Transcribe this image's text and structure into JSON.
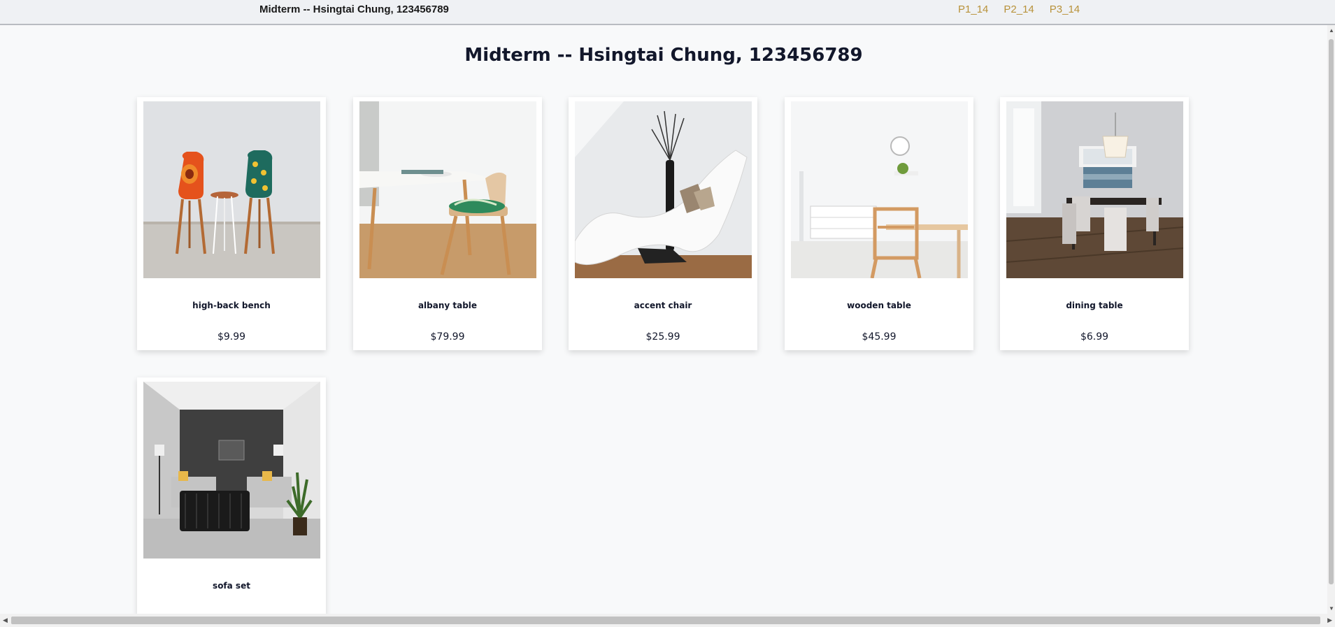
{
  "nav": {
    "brand": "Midterm -- Hsingtai Chung, 123456789",
    "links": [
      "P1_14",
      "P2_14",
      "P3_14"
    ]
  },
  "page": {
    "title": "Midterm -- Hsingtai Chung, 123456789"
  },
  "products": [
    {
      "name": "high-back bench",
      "price": "$9.99"
    },
    {
      "name": "albany table",
      "price": "$79.99"
    },
    {
      "name": "accent chair",
      "price": "$25.99"
    },
    {
      "name": "wooden table",
      "price": "$45.99"
    },
    {
      "name": "dining table",
      "price": "$6.99"
    },
    {
      "name": "sofa set",
      "price": ""
    }
  ],
  "colors": {
    "nav_background": "#eff1f4",
    "nav_link": "#b8923a",
    "page_background": "#f8f9fa",
    "text": "#12172b"
  }
}
